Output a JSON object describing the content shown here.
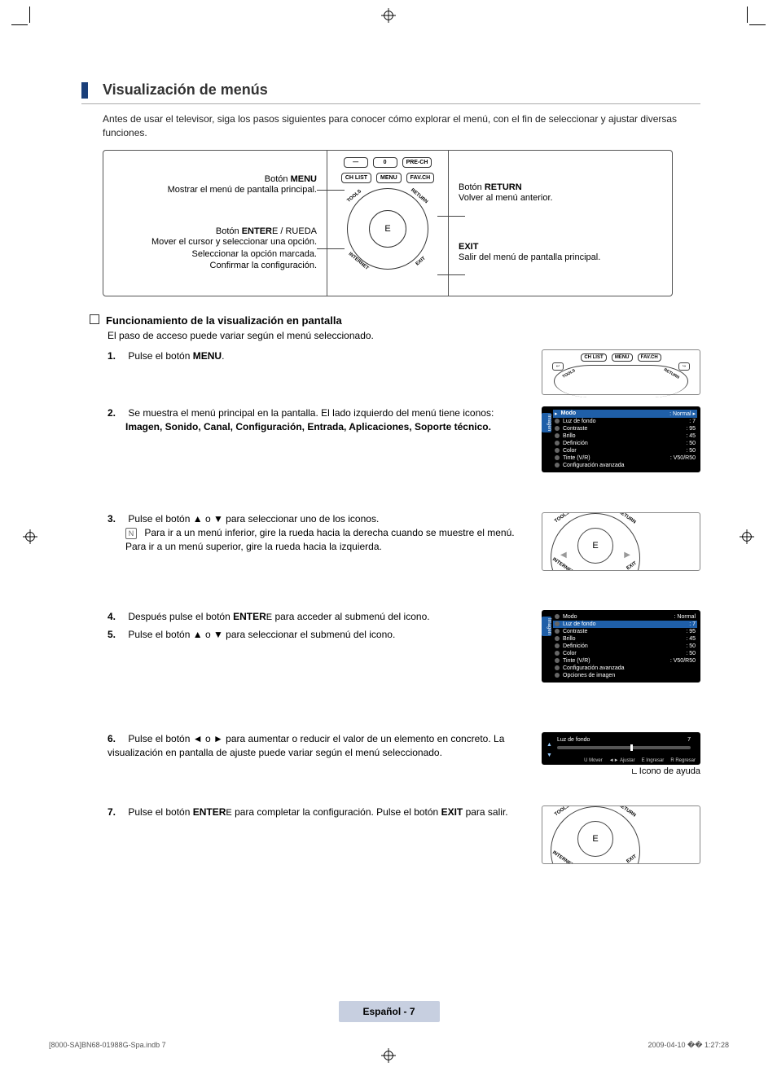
{
  "heading": "Visualización de menús",
  "intro": "Antes de usar el televisor, siga los pasos siguientes para conocer cómo explorar el menú, con el fin de seleccionar y ajustar diversas funciones.",
  "remote": {
    "left": {
      "menu": {
        "title": "Botón MENU",
        "desc": "Mostrar el menú de pantalla principal."
      },
      "enter": {
        "title": "Botón ENTER E / RUEDA",
        "desc": "Mover el cursor y seleccionar una opción.\nSeleccionar la opción marcada.\nConfirmar la configuración."
      }
    },
    "right": {
      "ret": {
        "title": "Botón RETURN",
        "desc": "Volver al menú anterior."
      },
      "exit": {
        "title": "EXIT",
        "desc": "Salir del menú de pantalla principal."
      }
    },
    "buttons": {
      "minus": "—",
      "zero": "0",
      "prech": "PRE-CH",
      "chlist": "CH LIST",
      "menu": "MENU",
      "favch": "FAV.CH",
      "tools": "TOOLS",
      "return": "RETURN",
      "internet": "INTERNET",
      "exit": "EXIT",
      "enter": "E"
    }
  },
  "subheading": "Funcionamiento de la visualización en pantalla",
  "subdesc": "El paso de acceso puede variar según el menú seleccionado.",
  "steps": {
    "s1": {
      "num": "1.",
      "text_a": "Pulse el botón ",
      "bold": "MENU",
      "text_b": "."
    },
    "s2": {
      "num": "2.",
      "text_a": "Se muestra el menú principal en la pantalla. El lado izquierdo del menú tiene iconos: ",
      "bold": "Imagen, Sonido, Canal, Configuración, Entrada, Aplicaciones, Soporte técnico."
    },
    "s3": {
      "num": "3.",
      "text": "Pulse el botón ▲ o ▼ para seleccionar uno de los iconos.",
      "note": "Para ir a un menú inferior, gire la rueda hacia la derecha cuando se muestre el menú. Para ir a un menú superior, gire la rueda hacia la izquierda."
    },
    "s4": {
      "num": "4.",
      "text_a": "Después pulse el botón ",
      "bold": "ENTER",
      "glyph": "E",
      "text_b": " para acceder al submenú del icono."
    },
    "s5": {
      "num": "5.",
      "text": "Pulse el botón ▲ o ▼ para seleccionar el submenú del icono."
    },
    "s6": {
      "num": "6.",
      "text": "Pulse el botón ◄ o ► para aumentar o reducir el valor de un elemento en concreto. La visualización en pantalla de ajuste puede variar según el menú seleccionado."
    },
    "s7": {
      "num": "7.",
      "text_a": "Pulse el botón ",
      "bold1": "ENTER",
      "glyph": "E",
      "text_b": " para completar la configuración. Pulse el botón ",
      "bold2": "EXIT",
      "text_c": " para salir."
    }
  },
  "osd1": {
    "sidetab": "Imagen",
    "rows": [
      {
        "l": "Modo",
        "v": ": Normal",
        "hi": true,
        "title": true
      },
      {
        "l": "Luz de fondo",
        "v": ": 7"
      },
      {
        "l": "Contraste",
        "v": ": 95"
      },
      {
        "l": "Brillo",
        "v": ": 45"
      },
      {
        "l": "Definición",
        "v": ": 50"
      },
      {
        "l": "Color",
        "v": ": 50"
      },
      {
        "l": "Tinte (V/R)",
        "v": ": V50/R50"
      },
      {
        "l": "Configuración avanzada",
        "v": ""
      }
    ]
  },
  "osd2": {
    "sidetab": "Imagen",
    "rows": [
      {
        "l": "Modo",
        "v": ": Normal"
      },
      {
        "l": "Luz de fondo",
        "v": ": 7",
        "hi": true
      },
      {
        "l": "Contraste",
        "v": ": 95"
      },
      {
        "l": "Brillo",
        "v": ": 45"
      },
      {
        "l": "Definición",
        "v": ": 50"
      },
      {
        "l": "Color",
        "v": ": 50"
      },
      {
        "l": "Tinte (V/R)",
        "v": ": V50/R50"
      },
      {
        "l": "Configuración avanzada",
        "v": ""
      },
      {
        "l": "Opciones de imagen",
        "v": ""
      }
    ]
  },
  "adjust": {
    "label": "Luz de fondo",
    "value": "7",
    "help": [
      "U Mover",
      "◄► Ajustar",
      "E Ingresar",
      "R Regresar"
    ]
  },
  "help_caption": "Icono de ayuda",
  "pagefoot": "Español - 7",
  "printfoot": {
    "left": "[8000-SA]BN68-01988G-Spa.indb   7",
    "right": "2009-04-10   �� 1:27:28"
  }
}
